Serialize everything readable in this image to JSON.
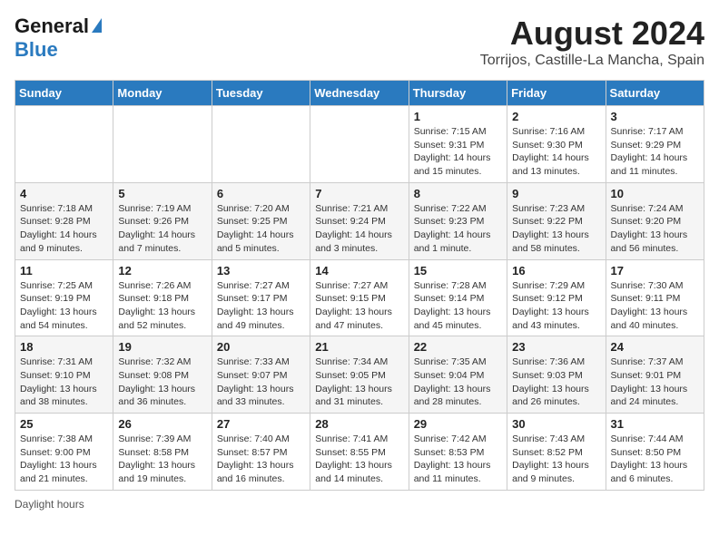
{
  "header": {
    "logo_line1": "General",
    "logo_line2": "Blue",
    "title": "August 2024",
    "subtitle": "Torrijos, Castille-La Mancha, Spain"
  },
  "calendar": {
    "weekdays": [
      "Sunday",
      "Monday",
      "Tuesday",
      "Wednesday",
      "Thursday",
      "Friday",
      "Saturday"
    ],
    "weeks": [
      [
        {
          "date": "",
          "info": ""
        },
        {
          "date": "",
          "info": ""
        },
        {
          "date": "",
          "info": ""
        },
        {
          "date": "",
          "info": ""
        },
        {
          "date": "1",
          "info": "Sunrise: 7:15 AM\nSunset: 9:31 PM\nDaylight: 14 hours and 15 minutes."
        },
        {
          "date": "2",
          "info": "Sunrise: 7:16 AM\nSunset: 9:30 PM\nDaylight: 14 hours and 13 minutes."
        },
        {
          "date": "3",
          "info": "Sunrise: 7:17 AM\nSunset: 9:29 PM\nDaylight: 14 hours and 11 minutes."
        }
      ],
      [
        {
          "date": "4",
          "info": "Sunrise: 7:18 AM\nSunset: 9:28 PM\nDaylight: 14 hours and 9 minutes."
        },
        {
          "date": "5",
          "info": "Sunrise: 7:19 AM\nSunset: 9:26 PM\nDaylight: 14 hours and 7 minutes."
        },
        {
          "date": "6",
          "info": "Sunrise: 7:20 AM\nSunset: 9:25 PM\nDaylight: 14 hours and 5 minutes."
        },
        {
          "date": "7",
          "info": "Sunrise: 7:21 AM\nSunset: 9:24 PM\nDaylight: 14 hours and 3 minutes."
        },
        {
          "date": "8",
          "info": "Sunrise: 7:22 AM\nSunset: 9:23 PM\nDaylight: 14 hours and 1 minute."
        },
        {
          "date": "9",
          "info": "Sunrise: 7:23 AM\nSunset: 9:22 PM\nDaylight: 13 hours and 58 minutes."
        },
        {
          "date": "10",
          "info": "Sunrise: 7:24 AM\nSunset: 9:20 PM\nDaylight: 13 hours and 56 minutes."
        }
      ],
      [
        {
          "date": "11",
          "info": "Sunrise: 7:25 AM\nSunset: 9:19 PM\nDaylight: 13 hours and 54 minutes."
        },
        {
          "date": "12",
          "info": "Sunrise: 7:26 AM\nSunset: 9:18 PM\nDaylight: 13 hours and 52 minutes."
        },
        {
          "date": "13",
          "info": "Sunrise: 7:27 AM\nSunset: 9:17 PM\nDaylight: 13 hours and 49 minutes."
        },
        {
          "date": "14",
          "info": "Sunrise: 7:27 AM\nSunset: 9:15 PM\nDaylight: 13 hours and 47 minutes."
        },
        {
          "date": "15",
          "info": "Sunrise: 7:28 AM\nSunset: 9:14 PM\nDaylight: 13 hours and 45 minutes."
        },
        {
          "date": "16",
          "info": "Sunrise: 7:29 AM\nSunset: 9:12 PM\nDaylight: 13 hours and 43 minutes."
        },
        {
          "date": "17",
          "info": "Sunrise: 7:30 AM\nSunset: 9:11 PM\nDaylight: 13 hours and 40 minutes."
        }
      ],
      [
        {
          "date": "18",
          "info": "Sunrise: 7:31 AM\nSunset: 9:10 PM\nDaylight: 13 hours and 38 minutes."
        },
        {
          "date": "19",
          "info": "Sunrise: 7:32 AM\nSunset: 9:08 PM\nDaylight: 13 hours and 36 minutes."
        },
        {
          "date": "20",
          "info": "Sunrise: 7:33 AM\nSunset: 9:07 PM\nDaylight: 13 hours and 33 minutes."
        },
        {
          "date": "21",
          "info": "Sunrise: 7:34 AM\nSunset: 9:05 PM\nDaylight: 13 hours and 31 minutes."
        },
        {
          "date": "22",
          "info": "Sunrise: 7:35 AM\nSunset: 9:04 PM\nDaylight: 13 hours and 28 minutes."
        },
        {
          "date": "23",
          "info": "Sunrise: 7:36 AM\nSunset: 9:03 PM\nDaylight: 13 hours and 26 minutes."
        },
        {
          "date": "24",
          "info": "Sunrise: 7:37 AM\nSunset: 9:01 PM\nDaylight: 13 hours and 24 minutes."
        }
      ],
      [
        {
          "date": "25",
          "info": "Sunrise: 7:38 AM\nSunset: 9:00 PM\nDaylight: 13 hours and 21 minutes."
        },
        {
          "date": "26",
          "info": "Sunrise: 7:39 AM\nSunset: 8:58 PM\nDaylight: 13 hours and 19 minutes."
        },
        {
          "date": "27",
          "info": "Sunrise: 7:40 AM\nSunset: 8:57 PM\nDaylight: 13 hours and 16 minutes."
        },
        {
          "date": "28",
          "info": "Sunrise: 7:41 AM\nSunset: 8:55 PM\nDaylight: 13 hours and 14 minutes."
        },
        {
          "date": "29",
          "info": "Sunrise: 7:42 AM\nSunset: 8:53 PM\nDaylight: 13 hours and 11 minutes."
        },
        {
          "date": "30",
          "info": "Sunrise: 7:43 AM\nSunset: 8:52 PM\nDaylight: 13 hours and 9 minutes."
        },
        {
          "date": "31",
          "info": "Sunrise: 7:44 AM\nSunset: 8:50 PM\nDaylight: 13 hours and 6 minutes."
        }
      ]
    ]
  },
  "footer": {
    "note": "Daylight hours"
  }
}
